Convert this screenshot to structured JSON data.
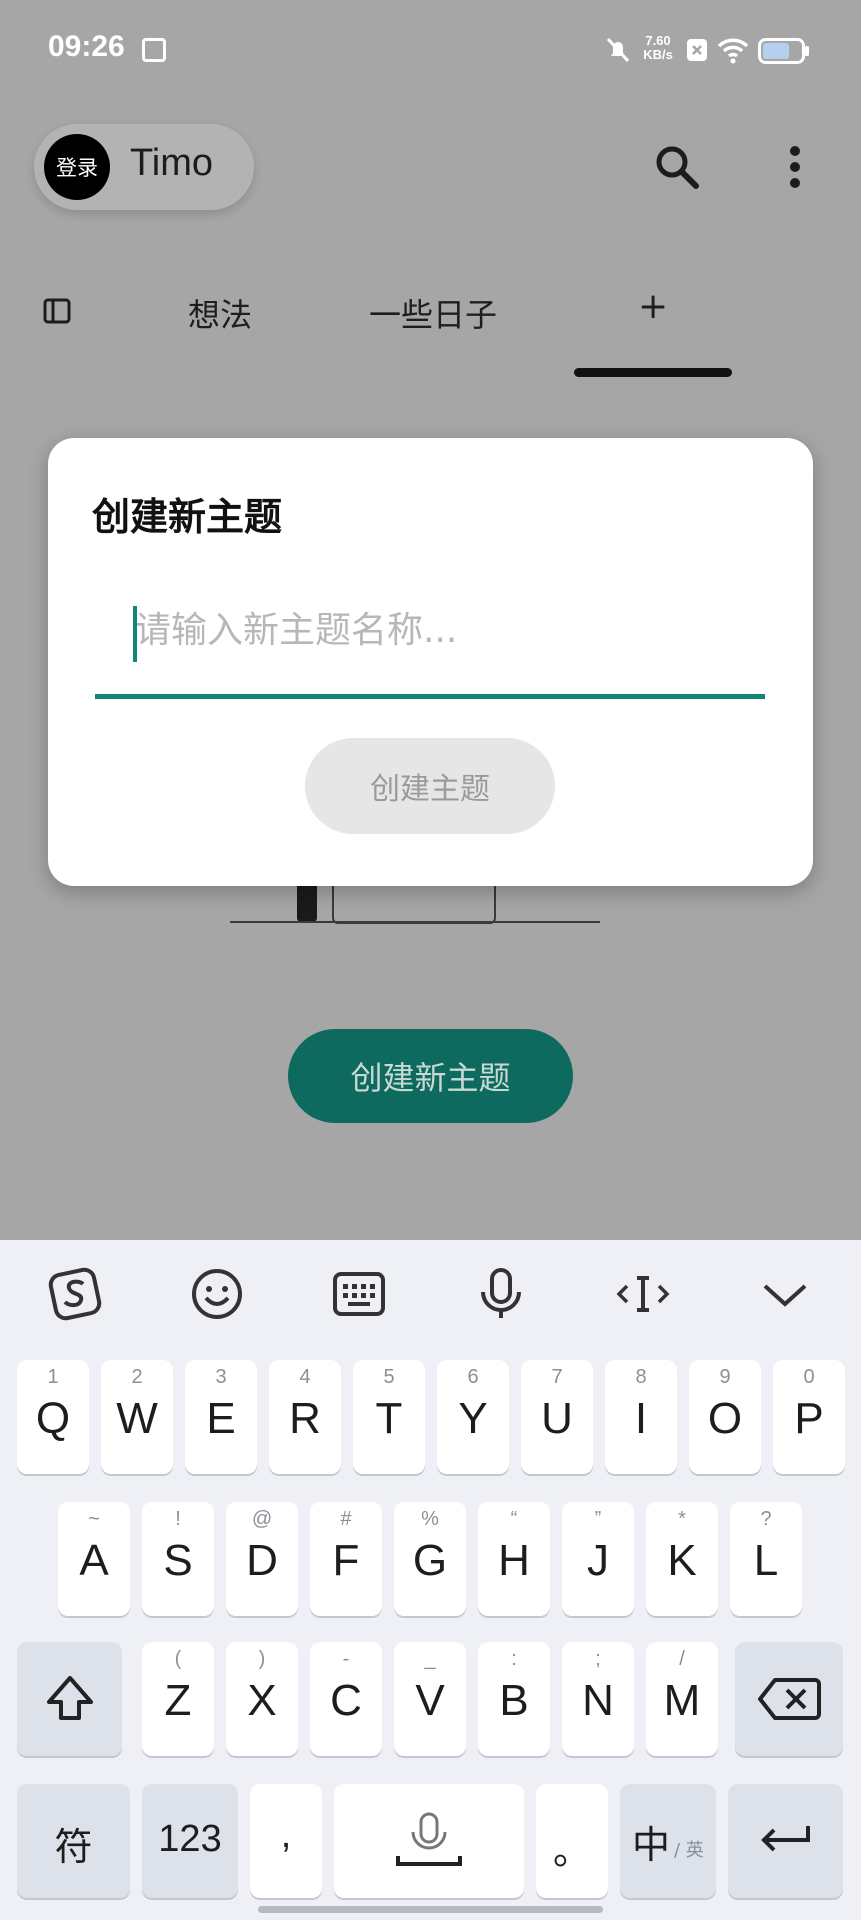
{
  "status_bar": {
    "time": "09:26",
    "net_speed_value": "7.60",
    "net_speed_unit": "KB/s"
  },
  "header": {
    "avatar_text": "登录",
    "user_name": "Timo"
  },
  "tabs": [
    {
      "label": "想法"
    },
    {
      "label": "一些日子"
    },
    {
      "label": "+"
    }
  ],
  "background": {
    "create_button_label": "创建新主题"
  },
  "dialog": {
    "title": "创建新主题",
    "input_value": "",
    "input_placeholder": "请输入新主题名称...",
    "create_button_label": "创建主题"
  },
  "keyboard": {
    "row1": [
      {
        "main": "Q",
        "sub": "1"
      },
      {
        "main": "W",
        "sub": "2"
      },
      {
        "main": "E",
        "sub": "3"
      },
      {
        "main": "R",
        "sub": "4"
      },
      {
        "main": "T",
        "sub": "5"
      },
      {
        "main": "Y",
        "sub": "6"
      },
      {
        "main": "U",
        "sub": "7"
      },
      {
        "main": "I",
        "sub": "8"
      },
      {
        "main": "O",
        "sub": "9"
      },
      {
        "main": "P",
        "sub": "0"
      }
    ],
    "row2": [
      {
        "main": "A",
        "sub": "~"
      },
      {
        "main": "S",
        "sub": "!"
      },
      {
        "main": "D",
        "sub": "@"
      },
      {
        "main": "F",
        "sub": "#"
      },
      {
        "main": "G",
        "sub": "%"
      },
      {
        "main": "H",
        "sub": "“"
      },
      {
        "main": "J",
        "sub": "”"
      },
      {
        "main": "K",
        "sub": "*"
      },
      {
        "main": "L",
        "sub": "?"
      }
    ],
    "row3": [
      {
        "main": "Z",
        "sub": "("
      },
      {
        "main": "X",
        "sub": ")"
      },
      {
        "main": "C",
        "sub": "-"
      },
      {
        "main": "V",
        "sub": "_"
      },
      {
        "main": "B",
        "sub": ":"
      },
      {
        "main": "N",
        "sub": ";"
      },
      {
        "main": "M",
        "sub": "/"
      }
    ],
    "symbols_label": "符",
    "numbers_label": "123",
    "comma_label": ",",
    "period_label": "。",
    "lang_main": "中",
    "lang_sub": "/ 英"
  },
  "colors": {
    "accent": "#118576",
    "primary_button": "#0e6a5e",
    "scrim": "#a6a6a6"
  }
}
